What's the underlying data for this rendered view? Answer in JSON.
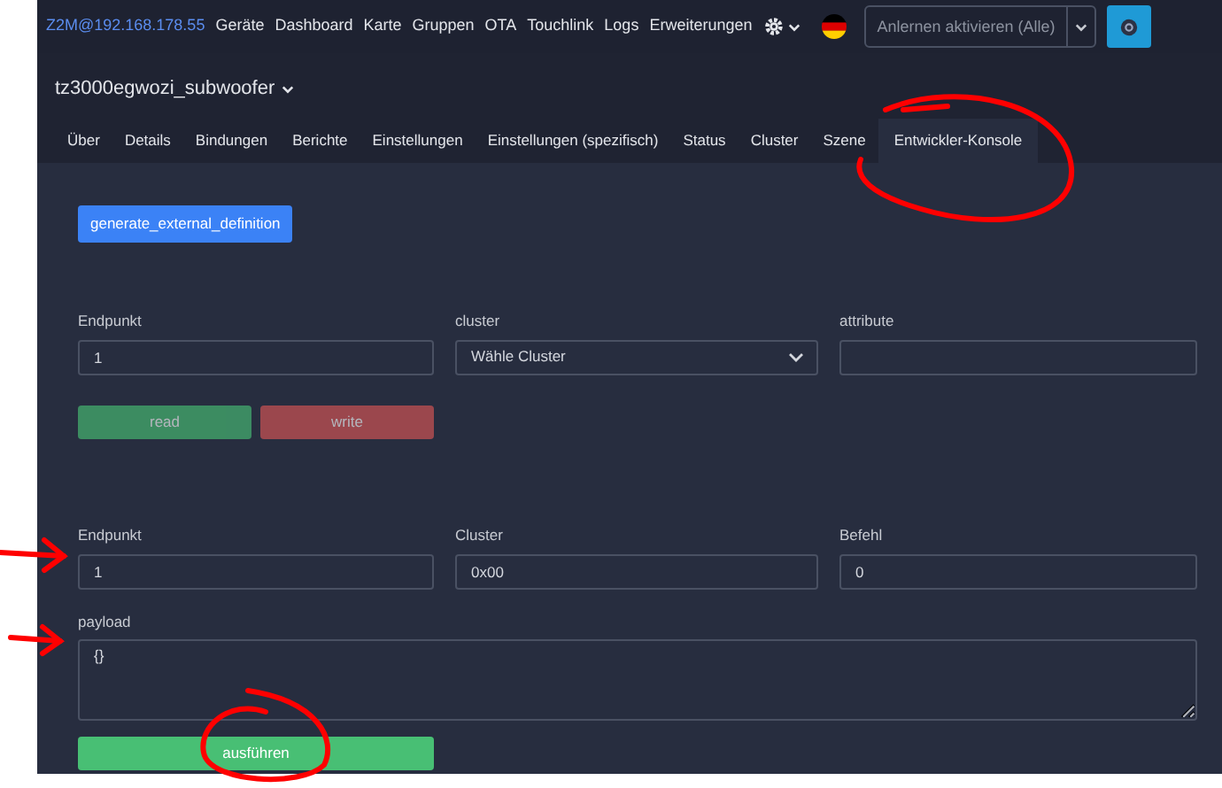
{
  "navbar": {
    "brand": "Z2M@192.168.178.55",
    "links": [
      "Geräte",
      "Dashboard",
      "Karte",
      "Gruppen",
      "OTA",
      "Touchlink",
      "Logs",
      "Erweiterungen"
    ],
    "permit_join": {
      "value": "Anlernen aktivieren (Alle)"
    }
  },
  "device": {
    "title": "tz3000egwozi_subwoofer"
  },
  "tabs": [
    {
      "label": "Über",
      "selected": false
    },
    {
      "label": "Details",
      "selected": false
    },
    {
      "label": "Bindungen",
      "selected": false
    },
    {
      "label": "Berichte",
      "selected": false
    },
    {
      "label": "Einstellungen",
      "selected": false
    },
    {
      "label": "Einstellungen (spezifisch)",
      "selected": false
    },
    {
      "label": "Status",
      "selected": false
    },
    {
      "label": "Cluster",
      "selected": false
    },
    {
      "label": "Szene",
      "selected": false
    },
    {
      "label": "Entwickler-Konsole",
      "selected": true
    }
  ],
  "generate_button": "generate_external_definition",
  "read_write": {
    "fields": [
      {
        "kind": "input",
        "label": "Endpunkt",
        "value": "1"
      },
      {
        "kind": "select",
        "label": "cluster",
        "value": "Wähle Cluster"
      },
      {
        "kind": "input",
        "label": "attribute"
      }
    ],
    "buttons": [
      {
        "kind": "success",
        "label": "read",
        "disabled": true
      },
      {
        "kind": "danger",
        "label": "write",
        "disabled": true
      }
    ]
  },
  "command": {
    "fields": [
      {
        "kind": "input",
        "label": "Endpunkt",
        "value": "1"
      },
      {
        "kind": "input",
        "label": "Cluster",
        "value": "0x00"
      },
      {
        "kind": "input",
        "label": "Befehl",
        "value": "0"
      }
    ],
    "payload": {
      "label": "payload",
      "value": "{}"
    },
    "execute_button": "ausführen"
  }
}
